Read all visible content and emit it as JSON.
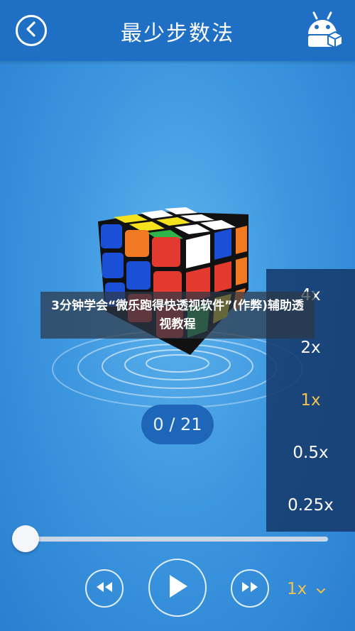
{
  "header": {
    "title": "最少步数法",
    "back_icon": "back-arrow-icon",
    "robot_icon": "android-robot-icon"
  },
  "counter": {
    "text": "0 / 21"
  },
  "speed_menu": {
    "options": [
      "4x",
      "2x",
      "1x",
      "0.5x",
      "0.25x"
    ],
    "selected": "1x"
  },
  "overlay": {
    "text": "3分钟学会“微乐跑得快透视软件”(作弊)辅助透视教程"
  },
  "playback": {
    "progress": 0,
    "rewind_icon": "rewind-icon",
    "play_icon": "play-icon",
    "forward_icon": "fast-forward-icon",
    "speed_label": "1x",
    "speed_chevron": "chevron-down-icon"
  },
  "colors": {
    "header_bg": "#1f6fc4",
    "accent_selected": "#f2c14b",
    "cube_red": "#e23a2e",
    "cube_blue": "#1c4fd8",
    "cube_orange": "#f07a22",
    "cube_yellow": "#f6e21c",
    "cube_green": "#2fb54a",
    "cube_white": "#ffffff"
  }
}
